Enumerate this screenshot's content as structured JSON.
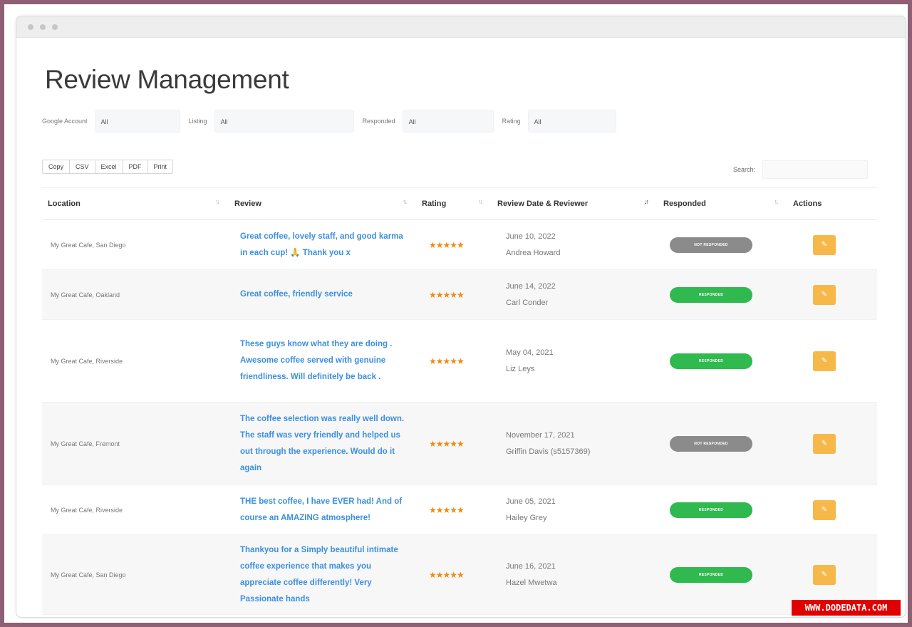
{
  "page": {
    "title": "Review Management"
  },
  "filters": [
    {
      "label": "Google Account",
      "value": "All"
    },
    {
      "label": "Listing",
      "value": "All"
    },
    {
      "label": "Responded",
      "value": "All"
    },
    {
      "label": "Rating",
      "value": "All"
    }
  ],
  "export_buttons": [
    "Copy",
    "CSV",
    "Excel",
    "PDF",
    "Print"
  ],
  "search": {
    "label": "Search:",
    "value": ""
  },
  "table": {
    "columns": [
      "Location",
      "Review",
      "Rating",
      "Review Date & Reviewer",
      "Responded",
      "Actions"
    ],
    "rows": [
      {
        "location": "My Great Cafe, San Diego",
        "review": "Great coffee, lovely staff, and good karma in each cup! 🙏 Thank you x",
        "stars": "★★★★★",
        "date": "June 10, 2022",
        "reviewer": "Andrea Howard",
        "responded": "NOT RESPONDED",
        "status": "notresp"
      },
      {
        "location": "My Great Cafe, Oakland",
        "review": "Great coffee, friendly service",
        "stars": "★★★★★",
        "date": "June 14, 2022",
        "reviewer": "Carl Conder",
        "responded": "RESPONDED",
        "status": "resp"
      },
      {
        "location": "My Great Cafe, Riverside",
        "review": "These guys know what they are doing . Awesome coffee served with genuine friendliness. Will definitely be back .",
        "stars": "★★★★★",
        "date": "May 04, 2021",
        "reviewer": "Liz Leys",
        "responded": "RESPONDED",
        "status": "resp"
      },
      {
        "location": "My Great Cafe, Fremont",
        "review": "The coffee selection was really well down. The staff was very friendly and helped us out through the experience. Would do it again",
        "stars": "★★★★★",
        "date": "November 17, 2021",
        "reviewer": "Griffin Davis (s5157369)",
        "responded": "NOT RESPONDED",
        "status": "notresp"
      },
      {
        "location": "My Great Cafe, Riverside",
        "review": "THE best coffee, I have EVER had! And of course an AMAZING atmosphere!",
        "stars": "★★★★★",
        "date": "June 05, 2021",
        "reviewer": "Hailey Grey",
        "responded": "RESPONDED",
        "status": "resp"
      },
      {
        "location": "My Great Cafe, San Diego",
        "review": "Thankyou for a Simply beautiful intimate coffee experience that makes you appreciate coffee differently! Very Passionate hands",
        "stars": "★★★★★",
        "date": "June 16, 2021",
        "reviewer": "Hazel Mwetwa",
        "responded": "RESPONDED",
        "status": "resp"
      }
    ]
  },
  "watermark": "WWW.DODEDATA.COM",
  "colors": {
    "responded": "#2fb94e",
    "not_responded": "#8b8b8b",
    "edit": "#f7b84a",
    "review_link": "#3b8fe0",
    "stars": "#f08a12"
  },
  "icons": {
    "sort": "sort-icon",
    "edit": "pencil-icon"
  }
}
